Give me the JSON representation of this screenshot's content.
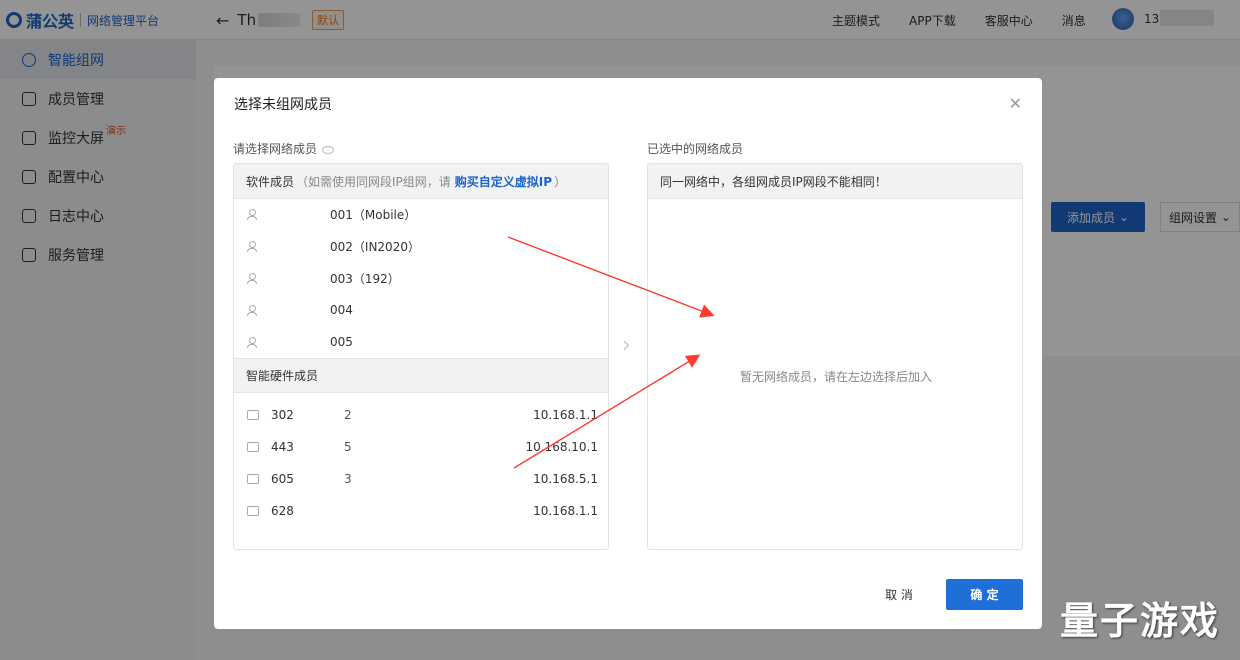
{
  "app": {
    "logo_name": "蒲公英",
    "logo_sub": "网络管理平台",
    "network_name": "Th",
    "default_tag": "默认"
  },
  "topnav": {
    "links": [
      "主题模式",
      "APP下载",
      "客服中心",
      "消息"
    ],
    "phone_prefix": "136"
  },
  "sidebar": {
    "items": [
      {
        "label": "智能组网",
        "active": true
      },
      {
        "label": "成员管理"
      },
      {
        "label": "监控大屏",
        "badge": "演示"
      },
      {
        "label": "配置中心"
      },
      {
        "label": "日志中心"
      },
      {
        "label": "服务管理"
      }
    ]
  },
  "background": {
    "add_member": "添加成员",
    "network_settings": "组网设置"
  },
  "modal": {
    "title": "选择未组网成员",
    "left_label": "请选择网络成员",
    "right_label": "已选中的网络成员",
    "software_head": "软件成员",
    "software_note": "（如需使用同网段IP组网，请",
    "software_link": "购买自定义虚拟IP",
    "software_note_end": "）",
    "software_members": [
      "001（Mobile）",
      "002（IN2020）",
      "003（192）",
      "004",
      "005"
    ],
    "hardware_head": "智能硬件成员",
    "hardware_members": [
      {
        "id": "302",
        "mid": "2",
        "ip": "10.168.1.1"
      },
      {
        "id": "443",
        "mid": "5",
        "ip": "10.168.10.1"
      },
      {
        "id": "605",
        "mid": "3",
        "ip": "10.168.5.1"
      },
      {
        "id": "628",
        "mid": "",
        "ip": "10.168.1.1"
      }
    ],
    "right_head": "同一网络中，各组网成员IP网段不能相同！",
    "empty_text": "暂无网络成员，请在左边选择后加入",
    "cancel": "取 消",
    "confirm": "确 定"
  },
  "annotation_color": "#ff3b30",
  "watermark": "量子游戏"
}
